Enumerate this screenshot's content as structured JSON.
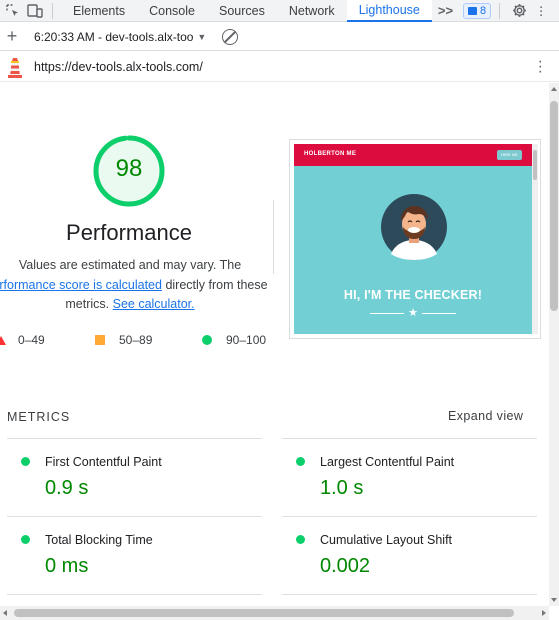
{
  "devtools": {
    "tabs": [
      "Elements",
      "Console",
      "Sources",
      "Network",
      "Lighthouse"
    ],
    "active_tab": "Lighthouse",
    "more_tabs": ">>",
    "issues_count": "8"
  },
  "toolbar": {
    "report_selector": "6:20:33 AM - dev-tools.alx-too"
  },
  "report": {
    "url": "https://dev-tools.alx-tools.com/",
    "category": {
      "score": 98,
      "score_label": "98",
      "title": "Performance",
      "desc_1": "Values are estimated and may vary. The",
      "link_1": "erformance score is calculated",
      "desc_2": " directly from these",
      "desc_3": "metrics. ",
      "link_2": "See calculator."
    },
    "legend": [
      {
        "range": "0–49",
        "color": "#ff3333",
        "shape": "triangle"
      },
      {
        "range": "50–89",
        "color": "#ffaa33",
        "shape": "square"
      },
      {
        "range": "90–100",
        "color": "#0cce6b",
        "shape": "circle"
      }
    ],
    "screenshot": {
      "brand": "HOLBERTON ME",
      "button": "HIRE ME",
      "headline": "HI, I'M THE CHECKER!",
      "nav_color": "#dc0c3f",
      "bg_color": "#72cfd4"
    },
    "metrics_heading": "METRICS",
    "expand_label": "Expand view",
    "metrics": [
      {
        "name": "First Contentful Paint",
        "value": "0.9 s"
      },
      {
        "name": "Largest Contentful Paint",
        "value": "1.0 s"
      },
      {
        "name": "Total Blocking Time",
        "value": "0 ms"
      },
      {
        "name": "Cumulative Layout Shift",
        "value": "0.002"
      }
    ],
    "pass_color": "#0cce6b"
  }
}
